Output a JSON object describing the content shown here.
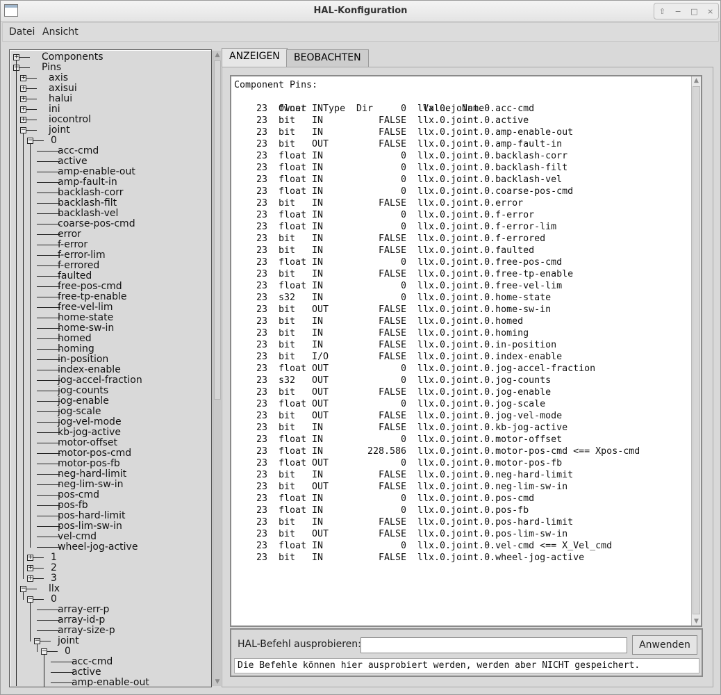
{
  "window": {
    "title": "HAL-Konfiguration",
    "controls": [
      "⇧",
      "−",
      "□",
      "×"
    ]
  },
  "menu": [
    "Datei",
    "Ansicht"
  ],
  "tree": {
    "items": [
      {
        "label": "Components",
        "depth": 0,
        "expand": "plus"
      },
      {
        "label": "Pins",
        "depth": 0,
        "expand": "minus"
      },
      {
        "label": "axis",
        "depth": 1,
        "expand": "plus"
      },
      {
        "label": "axisui",
        "depth": 1,
        "expand": "plus"
      },
      {
        "label": "halui",
        "depth": 1,
        "expand": "plus"
      },
      {
        "label": "ini",
        "depth": 1,
        "expand": "plus"
      },
      {
        "label": "iocontrol",
        "depth": 1,
        "expand": "plus"
      },
      {
        "label": "joint",
        "depth": 1,
        "expand": "minus"
      },
      {
        "label": "0",
        "depth": 2,
        "expand": "minus"
      },
      {
        "label": "acc-cmd",
        "depth": 3,
        "expand": "none"
      },
      {
        "label": "active",
        "depth": 3,
        "expand": "none"
      },
      {
        "label": "amp-enable-out",
        "depth": 3,
        "expand": "none"
      },
      {
        "label": "amp-fault-in",
        "depth": 3,
        "expand": "none"
      },
      {
        "label": "backlash-corr",
        "depth": 3,
        "expand": "none"
      },
      {
        "label": "backlash-filt",
        "depth": 3,
        "expand": "none"
      },
      {
        "label": "backlash-vel",
        "depth": 3,
        "expand": "none"
      },
      {
        "label": "coarse-pos-cmd",
        "depth": 3,
        "expand": "none"
      },
      {
        "label": "error",
        "depth": 3,
        "expand": "none"
      },
      {
        "label": "f-error",
        "depth": 3,
        "expand": "none"
      },
      {
        "label": "f-error-lim",
        "depth": 3,
        "expand": "none"
      },
      {
        "label": "f-errored",
        "depth": 3,
        "expand": "none"
      },
      {
        "label": "faulted",
        "depth": 3,
        "expand": "none"
      },
      {
        "label": "free-pos-cmd",
        "depth": 3,
        "expand": "none"
      },
      {
        "label": "free-tp-enable",
        "depth": 3,
        "expand": "none"
      },
      {
        "label": "free-vel-lim",
        "depth": 3,
        "expand": "none"
      },
      {
        "label": "home-state",
        "depth": 3,
        "expand": "none"
      },
      {
        "label": "home-sw-in",
        "depth": 3,
        "expand": "none"
      },
      {
        "label": "homed",
        "depth": 3,
        "expand": "none"
      },
      {
        "label": "homing",
        "depth": 3,
        "expand": "none"
      },
      {
        "label": "in-position",
        "depth": 3,
        "expand": "none"
      },
      {
        "label": "index-enable",
        "depth": 3,
        "expand": "none"
      },
      {
        "label": "jog-accel-fraction",
        "depth": 3,
        "expand": "none"
      },
      {
        "label": "jog-counts",
        "depth": 3,
        "expand": "none"
      },
      {
        "label": "jog-enable",
        "depth": 3,
        "expand": "none"
      },
      {
        "label": "jog-scale",
        "depth": 3,
        "expand": "none"
      },
      {
        "label": "jog-vel-mode",
        "depth": 3,
        "expand": "none"
      },
      {
        "label": "kb-jog-active",
        "depth": 3,
        "expand": "none"
      },
      {
        "label": "motor-offset",
        "depth": 3,
        "expand": "none"
      },
      {
        "label": "motor-pos-cmd",
        "depth": 3,
        "expand": "none"
      },
      {
        "label": "motor-pos-fb",
        "depth": 3,
        "expand": "none"
      },
      {
        "label": "neg-hard-limit",
        "depth": 3,
        "expand": "none"
      },
      {
        "label": "neg-lim-sw-in",
        "depth": 3,
        "expand": "none"
      },
      {
        "label": "pos-cmd",
        "depth": 3,
        "expand": "none"
      },
      {
        "label": "pos-fb",
        "depth": 3,
        "expand": "none"
      },
      {
        "label": "pos-hard-limit",
        "depth": 3,
        "expand": "none"
      },
      {
        "label": "pos-lim-sw-in",
        "depth": 3,
        "expand": "none"
      },
      {
        "label": "vel-cmd",
        "depth": 3,
        "expand": "none"
      },
      {
        "label": "wheel-jog-active",
        "depth": 3,
        "expand": "none"
      },
      {
        "label": "1",
        "depth": 2,
        "expand": "plus"
      },
      {
        "label": "2",
        "depth": 2,
        "expand": "plus"
      },
      {
        "label": "3",
        "depth": 2,
        "expand": "plus"
      },
      {
        "label": "llx",
        "depth": 1,
        "expand": "minus"
      },
      {
        "label": "0",
        "depth": 2,
        "expand": "minus"
      },
      {
        "label": "array-err-p",
        "depth": 3,
        "expand": "none"
      },
      {
        "label": "array-id-p",
        "depth": 3,
        "expand": "none"
      },
      {
        "label": "array-size-p",
        "depth": 3,
        "expand": "none"
      },
      {
        "label": "joint",
        "depth": 3,
        "expand": "minus"
      },
      {
        "label": "0",
        "depth": 4,
        "expand": "minus"
      },
      {
        "label": "acc-cmd",
        "depth": 5,
        "expand": "none"
      },
      {
        "label": "active",
        "depth": 5,
        "expand": "none"
      },
      {
        "label": "amp-enable-out",
        "depth": 5,
        "expand": "none"
      }
    ]
  },
  "tabs": [
    {
      "label": "ANZEIGEN",
      "active": true
    },
    {
      "label": "BEOBACHTEN",
      "active": false
    }
  ],
  "pins": {
    "title": "Component Pins:",
    "headers": {
      "owner": "Owner",
      "type": "Type",
      "dir": "Dir",
      "value": "Value",
      "name": "Name"
    },
    "rows": [
      {
        "owner": "23",
        "type": "float",
        "dir": "IN",
        "value": "0",
        "name": "llx.0.joint.0.acc-cmd"
      },
      {
        "owner": "23",
        "type": "bit",
        "dir": "IN",
        "value": "FALSE",
        "name": "llx.0.joint.0.active"
      },
      {
        "owner": "23",
        "type": "bit",
        "dir": "IN",
        "value": "FALSE",
        "name": "llx.0.joint.0.amp-enable-out"
      },
      {
        "owner": "23",
        "type": "bit",
        "dir": "OUT",
        "value": "FALSE",
        "name": "llx.0.joint.0.amp-fault-in"
      },
      {
        "owner": "23",
        "type": "float",
        "dir": "IN",
        "value": "0",
        "name": "llx.0.joint.0.backlash-corr"
      },
      {
        "owner": "23",
        "type": "float",
        "dir": "IN",
        "value": "0",
        "name": "llx.0.joint.0.backlash-filt"
      },
      {
        "owner": "23",
        "type": "float",
        "dir": "IN",
        "value": "0",
        "name": "llx.0.joint.0.backlash-vel"
      },
      {
        "owner": "23",
        "type": "float",
        "dir": "IN",
        "value": "0",
        "name": "llx.0.joint.0.coarse-pos-cmd"
      },
      {
        "owner": "23",
        "type": "bit",
        "dir": "IN",
        "value": "FALSE",
        "name": "llx.0.joint.0.error"
      },
      {
        "owner": "23",
        "type": "float",
        "dir": "IN",
        "value": "0",
        "name": "llx.0.joint.0.f-error"
      },
      {
        "owner": "23",
        "type": "float",
        "dir": "IN",
        "value": "0",
        "name": "llx.0.joint.0.f-error-lim"
      },
      {
        "owner": "23",
        "type": "bit",
        "dir": "IN",
        "value": "FALSE",
        "name": "llx.0.joint.0.f-errored"
      },
      {
        "owner": "23",
        "type": "bit",
        "dir": "IN",
        "value": "FALSE",
        "name": "llx.0.joint.0.faulted"
      },
      {
        "owner": "23",
        "type": "float",
        "dir": "IN",
        "value": "0",
        "name": "llx.0.joint.0.free-pos-cmd"
      },
      {
        "owner": "23",
        "type": "bit",
        "dir": "IN",
        "value": "FALSE",
        "name": "llx.0.joint.0.free-tp-enable"
      },
      {
        "owner": "23",
        "type": "float",
        "dir": "IN",
        "value": "0",
        "name": "llx.0.joint.0.free-vel-lim"
      },
      {
        "owner": "23",
        "type": "s32",
        "dir": "IN",
        "value": "0",
        "name": "llx.0.joint.0.home-state"
      },
      {
        "owner": "23",
        "type": "bit",
        "dir": "OUT",
        "value": "FALSE",
        "name": "llx.0.joint.0.home-sw-in"
      },
      {
        "owner": "23",
        "type": "bit",
        "dir": "IN",
        "value": "FALSE",
        "name": "llx.0.joint.0.homed"
      },
      {
        "owner": "23",
        "type": "bit",
        "dir": "IN",
        "value": "FALSE",
        "name": "llx.0.joint.0.homing"
      },
      {
        "owner": "23",
        "type": "bit",
        "dir": "IN",
        "value": "FALSE",
        "name": "llx.0.joint.0.in-position"
      },
      {
        "owner": "23",
        "type": "bit",
        "dir": "I/O",
        "value": "FALSE",
        "name": "llx.0.joint.0.index-enable"
      },
      {
        "owner": "23",
        "type": "float",
        "dir": "OUT",
        "value": "0",
        "name": "llx.0.joint.0.jog-accel-fraction"
      },
      {
        "owner": "23",
        "type": "s32",
        "dir": "OUT",
        "value": "0",
        "name": "llx.0.joint.0.jog-counts"
      },
      {
        "owner": "23",
        "type": "bit",
        "dir": "OUT",
        "value": "FALSE",
        "name": "llx.0.joint.0.jog-enable"
      },
      {
        "owner": "23",
        "type": "float",
        "dir": "OUT",
        "value": "0",
        "name": "llx.0.joint.0.jog-scale"
      },
      {
        "owner": "23",
        "type": "bit",
        "dir": "OUT",
        "value": "FALSE",
        "name": "llx.0.joint.0.jog-vel-mode"
      },
      {
        "owner": "23",
        "type": "bit",
        "dir": "IN",
        "value": "FALSE",
        "name": "llx.0.joint.0.kb-jog-active"
      },
      {
        "owner": "23",
        "type": "float",
        "dir": "IN",
        "value": "0",
        "name": "llx.0.joint.0.motor-offset"
      },
      {
        "owner": "23",
        "type": "float",
        "dir": "IN",
        "value": "228.586",
        "name": "llx.0.joint.0.motor-pos-cmd <== Xpos-cmd"
      },
      {
        "owner": "23",
        "type": "float",
        "dir": "OUT",
        "value": "0",
        "name": "llx.0.joint.0.motor-pos-fb"
      },
      {
        "owner": "23",
        "type": "bit",
        "dir": "IN",
        "value": "FALSE",
        "name": "llx.0.joint.0.neg-hard-limit"
      },
      {
        "owner": "23",
        "type": "bit",
        "dir": "OUT",
        "value": "FALSE",
        "name": "llx.0.joint.0.neg-lim-sw-in"
      },
      {
        "owner": "23",
        "type": "float",
        "dir": "IN",
        "value": "0",
        "name": "llx.0.joint.0.pos-cmd"
      },
      {
        "owner": "23",
        "type": "float",
        "dir": "IN",
        "value": "0",
        "name": "llx.0.joint.0.pos-fb"
      },
      {
        "owner": "23",
        "type": "bit",
        "dir": "IN",
        "value": "FALSE",
        "name": "llx.0.joint.0.pos-hard-limit"
      },
      {
        "owner": "23",
        "type": "bit",
        "dir": "OUT",
        "value": "FALSE",
        "name": "llx.0.joint.0.pos-lim-sw-in"
      },
      {
        "owner": "23",
        "type": "float",
        "dir": "IN",
        "value": "0",
        "name": "llx.0.joint.0.vel-cmd <== X_Vel_cmd"
      },
      {
        "owner": "23",
        "type": "bit",
        "dir": "IN",
        "value": "FALSE",
        "name": "llx.0.joint.0.wheel-jog-active"
      }
    ]
  },
  "command": {
    "label": "HAL-Befehl ausprobieren:",
    "input_value": "",
    "button_label": "Anwenden",
    "status": "Die Befehle können hier ausprobiert werden, werden aber NICHT gespeichert."
  }
}
